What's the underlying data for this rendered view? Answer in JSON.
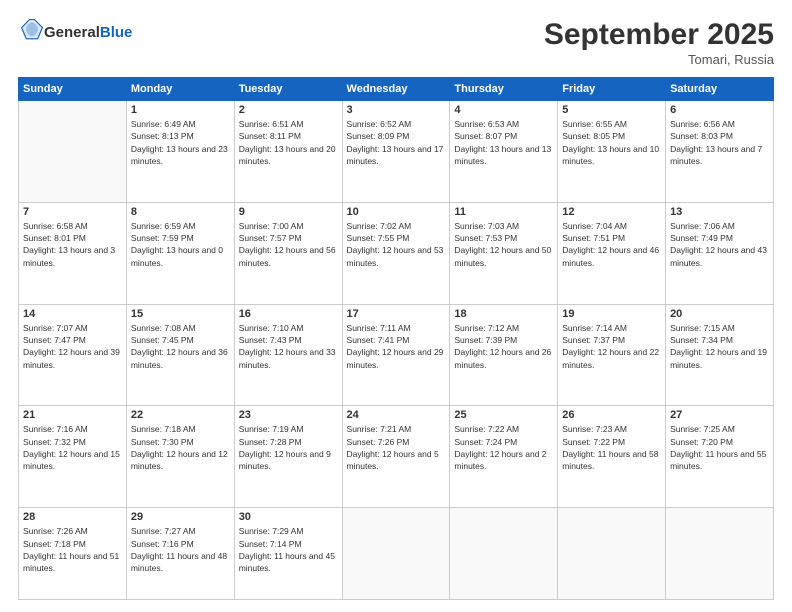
{
  "header": {
    "logo_general": "General",
    "logo_blue": "Blue",
    "month": "September 2025",
    "location": "Tomari, Russia"
  },
  "days_of_week": [
    "Sunday",
    "Monday",
    "Tuesday",
    "Wednesday",
    "Thursday",
    "Friday",
    "Saturday"
  ],
  "weeks": [
    [
      {
        "day": "",
        "sunrise": "",
        "sunset": "",
        "daylight": ""
      },
      {
        "day": "1",
        "sunrise": "Sunrise: 6:49 AM",
        "sunset": "Sunset: 8:13 PM",
        "daylight": "Daylight: 13 hours and 23 minutes."
      },
      {
        "day": "2",
        "sunrise": "Sunrise: 6:51 AM",
        "sunset": "Sunset: 8:11 PM",
        "daylight": "Daylight: 13 hours and 20 minutes."
      },
      {
        "day": "3",
        "sunrise": "Sunrise: 6:52 AM",
        "sunset": "Sunset: 8:09 PM",
        "daylight": "Daylight: 13 hours and 17 minutes."
      },
      {
        "day": "4",
        "sunrise": "Sunrise: 6:53 AM",
        "sunset": "Sunset: 8:07 PM",
        "daylight": "Daylight: 13 hours and 13 minutes."
      },
      {
        "day": "5",
        "sunrise": "Sunrise: 6:55 AM",
        "sunset": "Sunset: 8:05 PM",
        "daylight": "Daylight: 13 hours and 10 minutes."
      },
      {
        "day": "6",
        "sunrise": "Sunrise: 6:56 AM",
        "sunset": "Sunset: 8:03 PM",
        "daylight": "Daylight: 13 hours and 7 minutes."
      }
    ],
    [
      {
        "day": "7",
        "sunrise": "Sunrise: 6:58 AM",
        "sunset": "Sunset: 8:01 PM",
        "daylight": "Daylight: 13 hours and 3 minutes."
      },
      {
        "day": "8",
        "sunrise": "Sunrise: 6:59 AM",
        "sunset": "Sunset: 7:59 PM",
        "daylight": "Daylight: 13 hours and 0 minutes."
      },
      {
        "day": "9",
        "sunrise": "Sunrise: 7:00 AM",
        "sunset": "Sunset: 7:57 PM",
        "daylight": "Daylight: 12 hours and 56 minutes."
      },
      {
        "day": "10",
        "sunrise": "Sunrise: 7:02 AM",
        "sunset": "Sunset: 7:55 PM",
        "daylight": "Daylight: 12 hours and 53 minutes."
      },
      {
        "day": "11",
        "sunrise": "Sunrise: 7:03 AM",
        "sunset": "Sunset: 7:53 PM",
        "daylight": "Daylight: 12 hours and 50 minutes."
      },
      {
        "day": "12",
        "sunrise": "Sunrise: 7:04 AM",
        "sunset": "Sunset: 7:51 PM",
        "daylight": "Daylight: 12 hours and 46 minutes."
      },
      {
        "day": "13",
        "sunrise": "Sunrise: 7:06 AM",
        "sunset": "Sunset: 7:49 PM",
        "daylight": "Daylight: 12 hours and 43 minutes."
      }
    ],
    [
      {
        "day": "14",
        "sunrise": "Sunrise: 7:07 AM",
        "sunset": "Sunset: 7:47 PM",
        "daylight": "Daylight: 12 hours and 39 minutes."
      },
      {
        "day": "15",
        "sunrise": "Sunrise: 7:08 AM",
        "sunset": "Sunset: 7:45 PM",
        "daylight": "Daylight: 12 hours and 36 minutes."
      },
      {
        "day": "16",
        "sunrise": "Sunrise: 7:10 AM",
        "sunset": "Sunset: 7:43 PM",
        "daylight": "Daylight: 12 hours and 33 minutes."
      },
      {
        "day": "17",
        "sunrise": "Sunrise: 7:11 AM",
        "sunset": "Sunset: 7:41 PM",
        "daylight": "Daylight: 12 hours and 29 minutes."
      },
      {
        "day": "18",
        "sunrise": "Sunrise: 7:12 AM",
        "sunset": "Sunset: 7:39 PM",
        "daylight": "Daylight: 12 hours and 26 minutes."
      },
      {
        "day": "19",
        "sunrise": "Sunrise: 7:14 AM",
        "sunset": "Sunset: 7:37 PM",
        "daylight": "Daylight: 12 hours and 22 minutes."
      },
      {
        "day": "20",
        "sunrise": "Sunrise: 7:15 AM",
        "sunset": "Sunset: 7:34 PM",
        "daylight": "Daylight: 12 hours and 19 minutes."
      }
    ],
    [
      {
        "day": "21",
        "sunrise": "Sunrise: 7:16 AM",
        "sunset": "Sunset: 7:32 PM",
        "daylight": "Daylight: 12 hours and 15 minutes."
      },
      {
        "day": "22",
        "sunrise": "Sunrise: 7:18 AM",
        "sunset": "Sunset: 7:30 PM",
        "daylight": "Daylight: 12 hours and 12 minutes."
      },
      {
        "day": "23",
        "sunrise": "Sunrise: 7:19 AM",
        "sunset": "Sunset: 7:28 PM",
        "daylight": "Daylight: 12 hours and 9 minutes."
      },
      {
        "day": "24",
        "sunrise": "Sunrise: 7:21 AM",
        "sunset": "Sunset: 7:26 PM",
        "daylight": "Daylight: 12 hours and 5 minutes."
      },
      {
        "day": "25",
        "sunrise": "Sunrise: 7:22 AM",
        "sunset": "Sunset: 7:24 PM",
        "daylight": "Daylight: 12 hours and 2 minutes."
      },
      {
        "day": "26",
        "sunrise": "Sunrise: 7:23 AM",
        "sunset": "Sunset: 7:22 PM",
        "daylight": "Daylight: 11 hours and 58 minutes."
      },
      {
        "day": "27",
        "sunrise": "Sunrise: 7:25 AM",
        "sunset": "Sunset: 7:20 PM",
        "daylight": "Daylight: 11 hours and 55 minutes."
      }
    ],
    [
      {
        "day": "28",
        "sunrise": "Sunrise: 7:26 AM",
        "sunset": "Sunset: 7:18 PM",
        "daylight": "Daylight: 11 hours and 51 minutes."
      },
      {
        "day": "29",
        "sunrise": "Sunrise: 7:27 AM",
        "sunset": "Sunset: 7:16 PM",
        "daylight": "Daylight: 11 hours and 48 minutes."
      },
      {
        "day": "30",
        "sunrise": "Sunrise: 7:29 AM",
        "sunset": "Sunset: 7:14 PM",
        "daylight": "Daylight: 11 hours and 45 minutes."
      },
      {
        "day": "",
        "sunrise": "",
        "sunset": "",
        "daylight": ""
      },
      {
        "day": "",
        "sunrise": "",
        "sunset": "",
        "daylight": ""
      },
      {
        "day": "",
        "sunrise": "",
        "sunset": "",
        "daylight": ""
      },
      {
        "day": "",
        "sunrise": "",
        "sunset": "",
        "daylight": ""
      }
    ]
  ]
}
